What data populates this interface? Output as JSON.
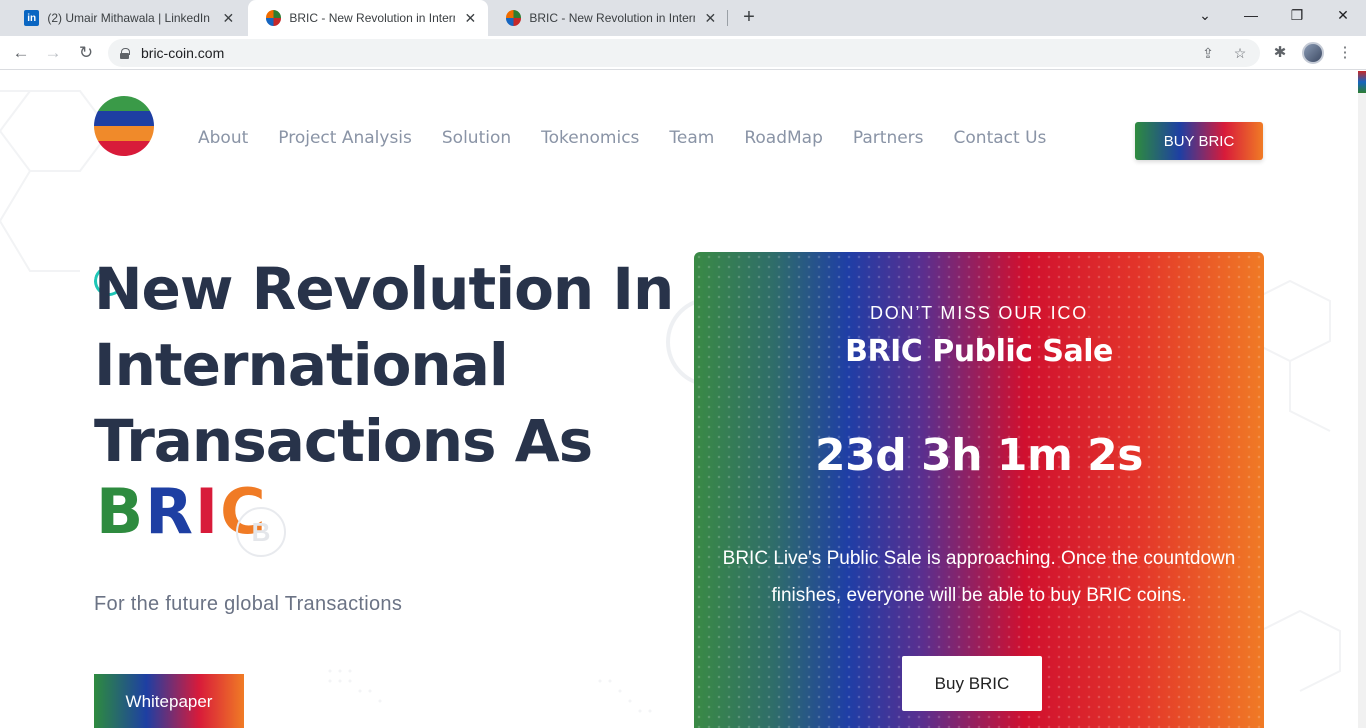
{
  "browser": {
    "tabs": [
      {
        "title": "(2) Umair Mithawala | LinkedIn",
        "icon": "linkedin-icon",
        "icon_text": "in"
      },
      {
        "title": "BRIC - New Revolution in Interna",
        "icon": "bric-favicon"
      },
      {
        "title": "BRIC - New Revolution in Interna",
        "icon": "bric-favicon"
      }
    ],
    "close_glyph": "✕",
    "new_tab_glyph": "+",
    "url": "bric-coin.com",
    "controls": {
      "minimize": "—",
      "restore": "❐",
      "close": "✕",
      "tab_search": "⌄"
    },
    "toolbar_glyphs": {
      "back": "←",
      "forward": "→",
      "reload": "↻",
      "share": "⇪",
      "star": "☆",
      "extensions": "✱",
      "menu": "⋮"
    }
  },
  "site": {
    "nav": [
      "About",
      "Project Analysis",
      "Solution",
      "Tokenomics",
      "Team",
      "RoadMap",
      "Partners",
      "Contact Us"
    ],
    "buy_button": "BUY BRIC",
    "hero": {
      "lines": [
        "New Revolution In",
        "International",
        "Transactions As"
      ],
      "bric_letters": [
        "B",
        "R",
        "I",
        "C"
      ],
      "bric_colors": [
        "#2e8b3f",
        "#1e3fa3",
        "#d81b3a",
        "#f07b25"
      ],
      "subtitle": "For the future global Transactions",
      "whitepaper_button": "Whitepaper"
    },
    "ico": {
      "kicker": "DON’T MISS OUR ICO",
      "title": "BRIC Public Sale",
      "countdown": "23d 3h 1m 2s",
      "description": "BRIC Live's Public Sale is approaching. Once the countdown finishes, everyone will be able to buy BRIC coins.",
      "button": "Buy BRIC"
    },
    "decor": {
      "coin_glyph": "B"
    }
  },
  "colors": {
    "accent_green": "#2e8b3f",
    "accent_blue": "#1e3fa3",
    "accent_red": "#d81b3a",
    "accent_orange": "#f07b25",
    "heading": "#28334a"
  }
}
